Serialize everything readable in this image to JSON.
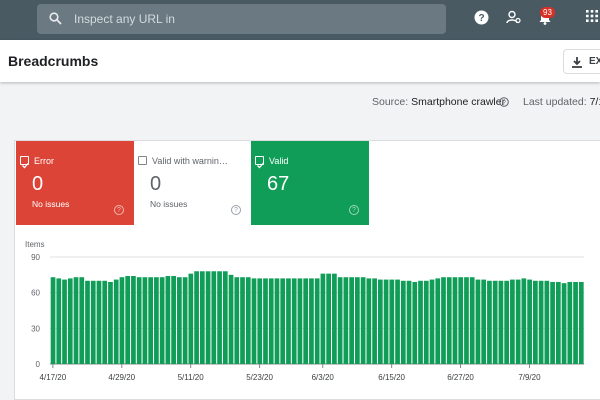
{
  "topbar": {
    "search_placeholder": "Inspect any URL in",
    "notification_count": "93"
  },
  "header": {
    "title": "Breadcrumbs",
    "export_label": "EX"
  },
  "meta": {
    "source_label": "Source:",
    "source_value": "Smartphone crawler",
    "last_updated_label": "Last updated:",
    "last_updated_value": "7/1"
  },
  "tiles": [
    {
      "label": "Error",
      "value": "0",
      "sub": "No issues",
      "checked": true,
      "color": "#dc4437"
    },
    {
      "label": "Valid with warnin…",
      "value": "0",
      "sub": "No issues",
      "checked": false,
      "color": "#ffffff"
    },
    {
      "label": "Valid",
      "value": "67",
      "sub": "",
      "checked": true,
      "color": "#0f9d58"
    }
  ],
  "colors": {
    "bar": "#0f9d58",
    "error": "#dc4437",
    "topbar": "#4a5a63"
  },
  "chart_data": {
    "type": "bar",
    "ylabel": "Items",
    "ylim": [
      0,
      90
    ],
    "yticks": [
      0,
      30,
      60,
      90
    ],
    "xtick_labels": [
      "4/17/20",
      "4/29/20",
      "5/11/20",
      "5/23/20",
      "6/3/20",
      "6/15/20",
      "6/27/20",
      "7/9/20"
    ],
    "xtick_index": [
      0,
      12,
      24,
      36,
      47,
      59,
      71,
      83
    ],
    "values": [
      73,
      72,
      71,
      72,
      73,
      73,
      70,
      70,
      70,
      70,
      69,
      71,
      73,
      74,
      74,
      73,
      73,
      73,
      73,
      73,
      74,
      74,
      73,
      73,
      76,
      78,
      78,
      78,
      78,
      78,
      78,
      75,
      73,
      73,
      73,
      72,
      72,
      72,
      72,
      72,
      72,
      72,
      72,
      72,
      72,
      72,
      72,
      76,
      76,
      76,
      73,
      73,
      73,
      73,
      73,
      72,
      72,
      71,
      71,
      71,
      71,
      70,
      70,
      69,
      70,
      70,
      71,
      72,
      73,
      73,
      73,
      73,
      73,
      73,
      71,
      71,
      70,
      70,
      70,
      70,
      71,
      71,
      72,
      71,
      70,
      70,
      70,
      69,
      69,
      68,
      69,
      69,
      69
    ]
  }
}
